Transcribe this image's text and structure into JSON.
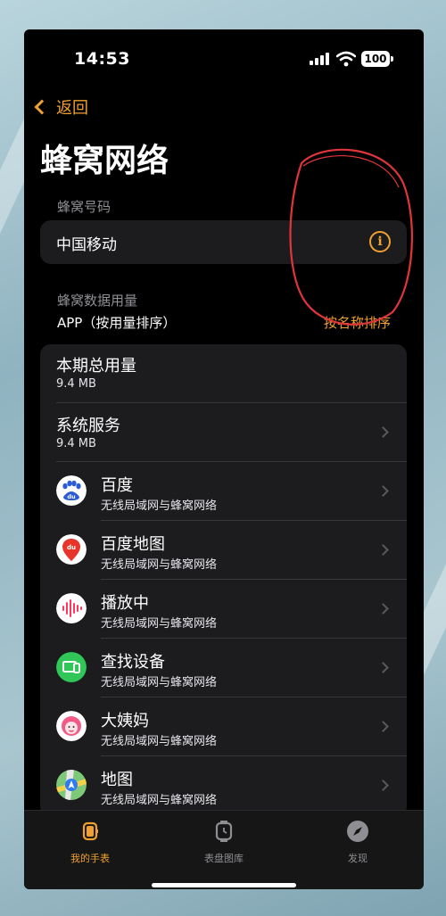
{
  "status_bar": {
    "time": "14:53",
    "battery": "100"
  },
  "nav": {
    "back_label": "返回"
  },
  "page": {
    "title": "蜂窝网络"
  },
  "carrier_section": {
    "label": "蜂窝号码",
    "carrier_name": "中国移动"
  },
  "usage_section": {
    "label": "蜂窝数据用量",
    "sort_caption": "APP（按用量排序）",
    "sort_link": "按名称排序"
  },
  "summary_rows": [
    {
      "title": "本期总用量",
      "subtitle": "9.4 MB"
    },
    {
      "title": "系统服务",
      "subtitle": "9.4 MB"
    }
  ],
  "apps": [
    {
      "name": "百度",
      "network": "无线局域网与蜂窝网络",
      "icon": "baidu-icon"
    },
    {
      "name": "百度地图",
      "network": "无线局域网与蜂窝网络",
      "icon": "baidu-map-icon"
    },
    {
      "name": "播放中",
      "network": "无线局域网与蜂窝网络",
      "icon": "now-playing-icon"
    },
    {
      "name": "查找设备",
      "network": "无线局域网与蜂窝网络",
      "icon": "find-devices-icon"
    },
    {
      "name": "大姨妈",
      "network": "无线局域网与蜂窝网络",
      "icon": "dayima-icon"
    },
    {
      "name": "地图",
      "network": "无线局域网与蜂窝网络",
      "icon": "maps-icon"
    }
  ],
  "tab_bar": {
    "tabs": [
      {
        "label": "我的手表",
        "icon": "watch-icon",
        "active": true
      },
      {
        "label": "表盘图库",
        "icon": "watch-face-gallery-icon",
        "active": false
      },
      {
        "label": "发现",
        "icon": "compass-icon",
        "active": false
      }
    ]
  },
  "colors": {
    "accent": "#f0a030",
    "card": "#1c1c1e",
    "annotation": "#e0353a"
  }
}
